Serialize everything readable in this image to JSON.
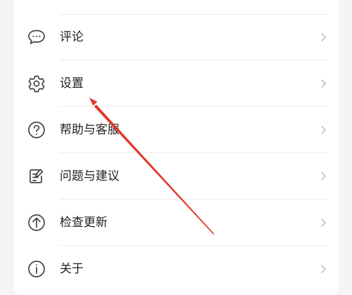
{
  "menu": {
    "items": [
      {
        "label": "评论",
        "icon": "comment-icon"
      },
      {
        "label": "设置",
        "icon": "gear-icon"
      },
      {
        "label": "帮助与客服",
        "icon": "question-icon"
      },
      {
        "label": "问题与建议",
        "icon": "feedback-edit-icon"
      },
      {
        "label": "检查更新",
        "icon": "update-arrow-icon"
      },
      {
        "label": "关于",
        "icon": "info-icon"
      }
    ]
  },
  "annotation": {
    "arrow_color": "#e0392b",
    "target": "设置"
  },
  "colors": {
    "background": "#f5f5f5",
    "card": "#ffffff",
    "text": "#222222",
    "icon": "#444444",
    "chevron": "#c2c2c2",
    "divider": "#ececec"
  }
}
